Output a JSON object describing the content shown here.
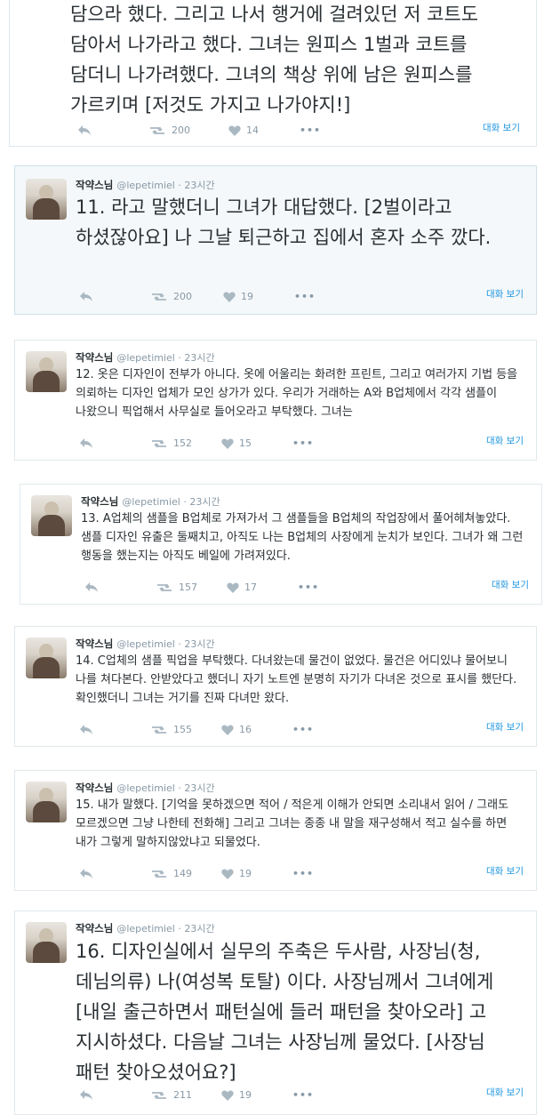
{
  "convo_label": "대화 보기",
  "more_label": "•••",
  "tweets": [
    {
      "author_name": "",
      "handle": "",
      "time": "",
      "text": "담으라 했다. 그리고 나서 행거에 걸려있던 저 코트도 담아서 나가라고 했다. 그녀는 원피스 1벌과 코트를 담더니 나가려했다. 그녀의 책상 위에 남은 원피스를 가르키며 [저것도 가지고 나가야지!]",
      "retweets": "200",
      "likes": "14"
    },
    {
      "author_name": "작약스님",
      "handle": "@lepetimiel",
      "time": "· 23시간",
      "text": "11. 라고 말했더니 그녀가 대답했다. [2벌이라고 하셨잖아요] 나 그날 퇴근하고 집에서 혼자 소주 깠다.",
      "retweets": "200",
      "likes": "19"
    },
    {
      "author_name": "작약스님",
      "handle": "@lepetimiel",
      "time": "· 23시간",
      "text": "12. 옷은 디자인이 전부가 아니다. 옷에 어울리는 화려한 프린트, 그리고 여러가지 기법 등을 의뢰하는 디자인 업체가 모인 상가가 있다. 우리가 거래하는 A와 B업체에서 각각 샘플이 나왔으니 픽업해서 사무실로 들어오라고 부탁했다. 그녀는",
      "retweets": "152",
      "likes": "15"
    },
    {
      "author_name": "작약스님",
      "handle": "@lepetimiel",
      "time": "· 23시간",
      "text": "13. A업체의 샘플을 B업체로 가져가서 그 샘플들을 B업체의 작업장에서 풀어헤쳐놓았다. 샘플 디자인 유출은 둘째치고, 아직도 나는 B업체의 사장에게 눈치가 보인다. 그녀가 왜 그런 행동을 했는지는 아직도 베일에 가려져있다.",
      "retweets": "157",
      "likes": "17"
    },
    {
      "author_name": "작약스님",
      "handle": "@lepetimiel",
      "time": "· 23시간",
      "text": "14. C업체의 샘플 픽업을 부탁했다. 다녀왔는데 물건이 없었다. 물건은 어디있냐 물어보니 나를 쳐다본다. 안받았다고 했더니 자기 노트엔 분명히 자기가 다녀온 것으로 표시를 했단다. 확인했더니 그녀는 거기를 진짜 다녀만 왔다.",
      "retweets": "155",
      "likes": "16"
    },
    {
      "author_name": "작약스님",
      "handle": "@lepetimiel",
      "time": "· 23시간",
      "text": "15. 내가 말했다. [기억을 못하겠으면 적어 / 적은게 이해가 안되면 소리내서 읽어 / 그래도 모르겠으면 그냥 나한테 전화해] 그리고 그녀는 종종 내 말을 재구성해서 적고 실수를 하면 내가 그렇게 말하지않았냐고 되물었다.",
      "retweets": "149",
      "likes": "19"
    },
    {
      "author_name": "작약스님",
      "handle": "@lepetimiel",
      "time": "· 23시간",
      "text": "16. 디자인실에서 실무의 주축은 두사람, 사장님(청,데님의류) 나(여성복 토탈) 이다. 사장님께서 그녀에게 [내일 출근하면서 패턴실에 들러 패턴을 찾아오라] 고 지시하셨다. 다음날 그녀는 사장님께 물었다. [사장님 패턴 찾아오셨어요?]",
      "retweets": "211",
      "likes": "19"
    }
  ]
}
